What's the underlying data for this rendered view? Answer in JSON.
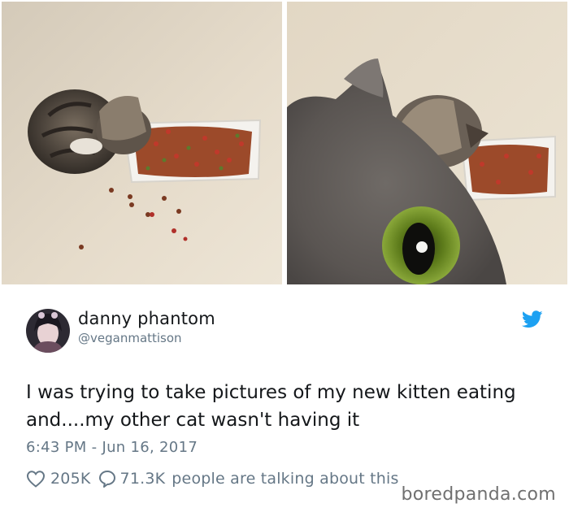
{
  "photos": [
    {
      "subject": "kitten-eating-photo"
    },
    {
      "subject": "cat-photobomb-photo"
    }
  ],
  "tweet": {
    "display_name": "danny phantom",
    "handle": "@veganmattison",
    "text": "I was trying to take pictures of my new kitten eating and....my other cat wasn't having it",
    "timestamp": "6:43 PM - Jun 16, 2017",
    "likes": "205K",
    "replies": "71.3K",
    "talking_text": "people are talking about this"
  },
  "watermark": "boredpanda.com",
  "colors": {
    "text_primary": "#14171a",
    "text_secondary": "#657786",
    "twitter_blue": "#1da1f2"
  },
  "icons": {
    "brand": "twitter-bird-icon",
    "like": "heart-outline-icon",
    "reply": "speech-bubble-icon"
  }
}
